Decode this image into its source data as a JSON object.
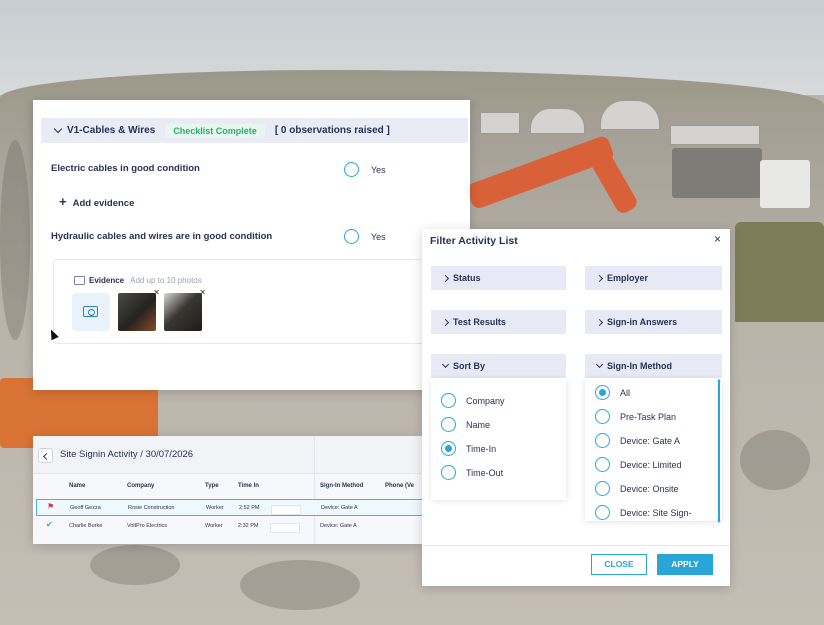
{
  "checklist": {
    "section_title": "V1-Cables & Wires",
    "status_badge": "Checklist Complete",
    "observations": "[ 0 observations raised ]",
    "questions": [
      {
        "text": "Electric cables in good condition",
        "answer": "Yes"
      },
      {
        "text": "Hydraulic cables and wires are in good condition",
        "answer": "Yes"
      }
    ],
    "add_evidence_label": "Add evidence",
    "evidence": {
      "title": "Evidence",
      "hint": "Add up to 10 photos"
    }
  },
  "signin": {
    "title": "Site Signin Activity / 30/07/2026",
    "columns": [
      "Name",
      "Company",
      "Type",
      "Time In",
      "Sign-In Method",
      "Phone (Ve"
    ],
    "rows": [
      {
        "name": "Geoff Gezza",
        "company": "Rosie Construction",
        "type": "Worker",
        "time_in": "2:52 PM",
        "method": "Device: Gate A"
      },
      {
        "name": "Charlie Burke",
        "company": "VoltPro Electrics",
        "type": "Worker",
        "time_in": "2:32 PM",
        "method": "Device: Gate A"
      }
    ]
  },
  "filter": {
    "title": "Filter Activity List",
    "close_icon": "×",
    "sections": {
      "status": "Status",
      "employer": "Employer",
      "test_results": "Test Results",
      "signin_answers": "Sign-in Answers",
      "sort_by": "Sort By",
      "signin_method": "Sign-In Method"
    },
    "sort_options": [
      "Company",
      "Name",
      "Time-In",
      "Time-Out"
    ],
    "sort_selected": "Time-In",
    "method_options": [
      "All",
      "Pre-Task Plan",
      "Device: Gate A",
      "Device: Limited",
      "Device: Onsite",
      "Device: Site Sign-"
    ],
    "method_selected": "All",
    "close_button": "CLOSE",
    "apply_button": "APPLY"
  },
  "colors": {
    "accent": "#2aa5d8",
    "navy": "#283255",
    "success": "#2faf6a",
    "flag": "#d9304a"
  }
}
